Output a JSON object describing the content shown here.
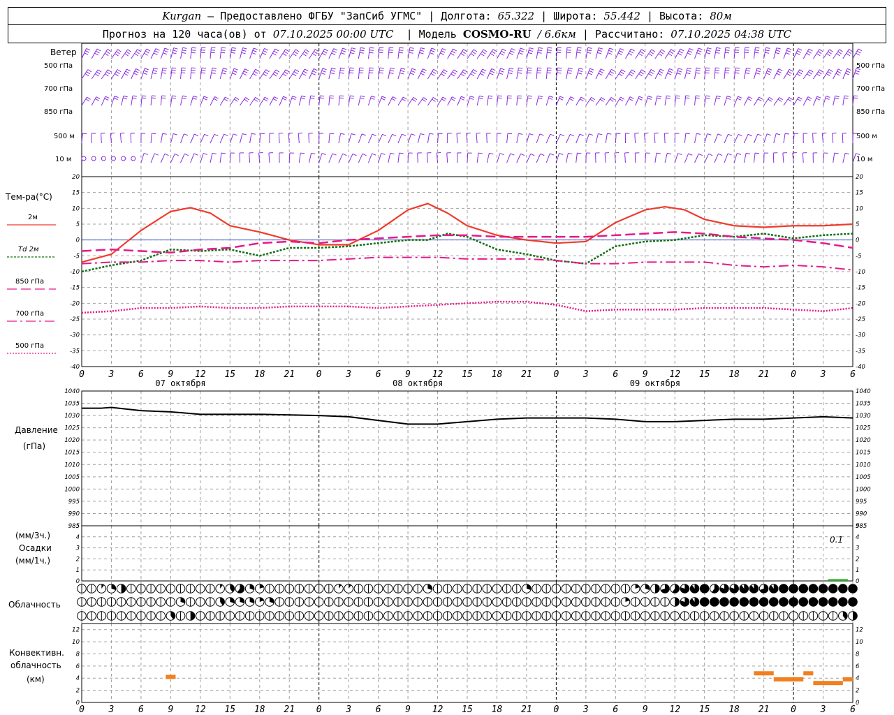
{
  "header": {
    "station": "Kurgan",
    "dash": "—",
    "provider": "Предоставлено ФГБУ \"ЗапСиб УГМС\"",
    "lon_label": "Долгота:",
    "lon": "65.322",
    "lat_label": "Широта:",
    "lat": "55.442",
    "alt_label": "Высота:",
    "alt": "80м",
    "forecast_label": "Прогноз на 120 часа(ов) от",
    "init_time": "07.10.2025 00:00 UTC",
    "model_label": "Модель",
    "model": "COSMO-RU",
    "resolution": "/ 6.6км",
    "calc_label": "Рассчитано:",
    "calc_time": "07.10.2025 04:38 UTC",
    "sep": "|"
  },
  "colors": {
    "wind": "#8a2be2",
    "t2m": "#ef3b2c",
    "td2m": "#107010",
    "t850": "#e6198a",
    "t700": "#e6198a",
    "t500": "#e6198a",
    "pressure": "#000000",
    "precip": "#20b020",
    "convective": "#f08020",
    "grid": "#a0a0a0"
  },
  "wind_panel": {
    "title": "Ветер",
    "levels": [
      "500 гПа",
      "700 гПа",
      "850 гПа",
      "500 м",
      "10 м"
    ]
  },
  "temp_panel": {
    "title": "Тем-ра(°С)",
    "legend": [
      {
        "label": "2м",
        "style": "solid"
      },
      {
        "label": "Td  2м",
        "style": "dotted"
      },
      {
        "label": "850 гПа",
        "style": "dashed"
      },
      {
        "label": "700 гПа",
        "style": "dashdot"
      },
      {
        "label": "500 гПа",
        "style": "fine-dotted"
      }
    ]
  },
  "pressure_panel": {
    "title": "Давление",
    "unit": "(гПа)"
  },
  "precip_panel": {
    "unit_top": "(мм/3ч.)",
    "title": "Осадки",
    "unit_bottom": "(мм/1ч.)",
    "max_label": "0.1"
  },
  "cloud_panel": {
    "title": "Облачность"
  },
  "conv_panel": {
    "title_1": "Конвективн.",
    "title_2": "облачность",
    "unit": "(км)"
  },
  "time_axis": {
    "tick_labels": [
      "0",
      "3",
      "6",
      "9",
      "12",
      "15",
      "18",
      "21",
      "0",
      "3",
      "6",
      "9",
      "12",
      "15",
      "18",
      "21",
      "0",
      "3",
      "6",
      "9",
      "12",
      "15",
      "18",
      "21",
      "0",
      "3",
      "6"
    ],
    "day_labels": [
      "07 октября",
      "08 октября",
      "09 октября"
    ]
  },
  "chart_data": [
    {
      "type": "line",
      "title": "Тем-ра(°С)",
      "x_unit": "hours since 07.10.2025 00:00 UTC",
      "ylim": [
        -40,
        20
      ],
      "yticks": [
        20,
        15,
        10,
        5,
        0,
        -5,
        -10,
        -15,
        -20,
        -25,
        -30,
        -35,
        -40
      ],
      "series": [
        {
          "name": "2м",
          "points": [
            [
              0,
              -7
            ],
            [
              3,
              -4.5
            ],
            [
              6,
              3
            ],
            [
              9,
              9
            ],
            [
              11,
              10.2
            ],
            [
              13,
              8.5
            ],
            [
              15,
              4.5
            ],
            [
              18,
              2.5
            ],
            [
              21,
              0
            ],
            [
              24,
              -1.5
            ],
            [
              27,
              -1.5
            ],
            [
              30,
              3
            ],
            [
              33,
              9.5
            ],
            [
              35,
              11.5
            ],
            [
              37,
              8.5
            ],
            [
              39,
              4.5
            ],
            [
              42,
              1.5
            ],
            [
              45,
              0
            ],
            [
              48,
              -1
            ],
            [
              51,
              -0.5
            ],
            [
              54,
              5.5
            ],
            [
              57,
              9.5
            ],
            [
              59,
              10.5
            ],
            [
              61,
              9.5
            ],
            [
              63,
              6.5
            ],
            [
              66,
              4.5
            ],
            [
              69,
              4
            ],
            [
              72,
              4.5
            ],
            [
              75,
              4.5
            ],
            [
              78,
              5
            ]
          ]
        },
        {
          "name": "Td  2м",
          "points": [
            [
              0,
              -10
            ],
            [
              3,
              -8
            ],
            [
              6,
              -6.5
            ],
            [
              9,
              -3
            ],
            [
              12,
              -3.5
            ],
            [
              15,
              -3
            ],
            [
              18,
              -5
            ],
            [
              21,
              -2.5
            ],
            [
              24,
              -2.5
            ],
            [
              27,
              -2
            ],
            [
              30,
              -1
            ],
            [
              33,
              0
            ],
            [
              35,
              0
            ],
            [
              37,
              2
            ],
            [
              39,
              1
            ],
            [
              42,
              -3
            ],
            [
              45,
              -4.5
            ],
            [
              48,
              -6.5
            ],
            [
              51,
              -7.5
            ],
            [
              54,
              -2
            ],
            [
              57,
              -0.5
            ],
            [
              60,
              0
            ],
            [
              63,
              1.5
            ],
            [
              66,
              1
            ],
            [
              69,
              2
            ],
            [
              72,
              0.5
            ],
            [
              75,
              1.5
            ],
            [
              78,
              2
            ]
          ]
        },
        {
          "name": "850 гПа",
          "points": [
            [
              0,
              -3.5
            ],
            [
              3,
              -3
            ],
            [
              6,
              -3.5
            ],
            [
              9,
              -4
            ],
            [
              12,
              -3
            ],
            [
              15,
              -2.5
            ],
            [
              18,
              -1
            ],
            [
              21,
              -0.5
            ],
            [
              24,
              -1
            ],
            [
              27,
              0
            ],
            [
              30,
              0.5
            ],
            [
              33,
              1
            ],
            [
              36,
              1.5
            ],
            [
              39,
              1.5
            ],
            [
              42,
              1
            ],
            [
              45,
              1
            ],
            [
              48,
              1
            ],
            [
              51,
              1
            ],
            [
              54,
              1.5
            ],
            [
              57,
              2
            ],
            [
              60,
              2.5
            ],
            [
              63,
              2
            ],
            [
              66,
              1
            ],
            [
              69,
              0.5
            ],
            [
              72,
              0
            ],
            [
              75,
              -1
            ],
            [
              78,
              -2.5
            ]
          ]
        },
        {
          "name": "700 гПа",
          "points": [
            [
              0,
              -7.5
            ],
            [
              3,
              -7
            ],
            [
              6,
              -7
            ],
            [
              9,
              -6.5
            ],
            [
              12,
              -6.5
            ],
            [
              15,
              -7
            ],
            [
              18,
              -6.5
            ],
            [
              21,
              -6.5
            ],
            [
              24,
              -6.5
            ],
            [
              27,
              -6
            ],
            [
              30,
              -5.5
            ],
            [
              33,
              -5.5
            ],
            [
              36,
              -5.5
            ],
            [
              39,
              -6
            ],
            [
              42,
              -6
            ],
            [
              45,
              -6
            ],
            [
              48,
              -6.5
            ],
            [
              51,
              -7.5
            ],
            [
              54,
              -7.5
            ],
            [
              57,
              -7
            ],
            [
              60,
              -7
            ],
            [
              63,
              -7
            ],
            [
              66,
              -8
            ],
            [
              69,
              -8.5
            ],
            [
              72,
              -8
            ],
            [
              75,
              -8.5
            ],
            [
              78,
              -9.5
            ]
          ]
        },
        {
          "name": "500 гПа",
          "points": [
            [
              0,
              -23
            ],
            [
              3,
              -22.5
            ],
            [
              6,
              -21.5
            ],
            [
              9,
              -21.5
            ],
            [
              12,
              -21
            ],
            [
              15,
              -21.5
            ],
            [
              18,
              -21.5
            ],
            [
              21,
              -21
            ],
            [
              24,
              -21
            ],
            [
              27,
              -21
            ],
            [
              30,
              -21.5
            ],
            [
              33,
              -21
            ],
            [
              36,
              -20.5
            ],
            [
              39,
              -20
            ],
            [
              42,
              -19.5
            ],
            [
              45,
              -19.5
            ],
            [
              48,
              -20.5
            ],
            [
              51,
              -22.5
            ],
            [
              54,
              -22
            ],
            [
              57,
              -22
            ],
            [
              60,
              -22
            ],
            [
              63,
              -21.5
            ],
            [
              66,
              -21.5
            ],
            [
              69,
              -21.5
            ],
            [
              72,
              -22
            ],
            [
              75,
              -22.5
            ],
            [
              78,
              -21.5
            ]
          ]
        }
      ]
    },
    {
      "type": "line",
      "title": "Давление",
      "x_unit": "hours since 07.10.2025 00:00 UTC",
      "ylim": [
        985,
        1040
      ],
      "yticks": [
        1040,
        1035,
        1030,
        1025,
        1020,
        1015,
        1010,
        1005,
        1000,
        995,
        990,
        985
      ],
      "series": [
        {
          "points": [
            [
              0,
              1033
            ],
            [
              2,
              1033
            ],
            [
              3,
              1033.3
            ],
            [
              6,
              1032
            ],
            [
              9,
              1031.5
            ],
            [
              12,
              1030.5
            ],
            [
              18,
              1030.5
            ],
            [
              24,
              1030
            ],
            [
              27,
              1029.5
            ],
            [
              30,
              1028
            ],
            [
              33,
              1026.5
            ],
            [
              36,
              1026.5
            ],
            [
              39,
              1027.5
            ],
            [
              42,
              1028.5
            ],
            [
              45,
              1029
            ],
            [
              48,
              1029
            ],
            [
              51,
              1029
            ],
            [
              54,
              1028.5
            ],
            [
              57,
              1027.5
            ],
            [
              60,
              1027.5
            ],
            [
              63,
              1028
            ],
            [
              66,
              1028.5
            ],
            [
              69,
              1028.5
            ],
            [
              72,
              1029
            ],
            [
              75,
              1029.5
            ],
            [
              78,
              1029
            ]
          ]
        }
      ]
    },
    {
      "type": "bar",
      "title": "Осадки",
      "x_unit": "hours since 07.10.2025 00:00 UTC",
      "ylim": [
        0,
        5
      ],
      "yticks": [
        5,
        4,
        3,
        2,
        1,
        0
      ],
      "values": [
        [
          76,
          0.1
        ],
        [
          77,
          0.1
        ]
      ]
    },
    {
      "type": "table",
      "title": "Облачность",
      "hours": [
        0,
        1,
        2,
        3,
        4,
        5,
        6,
        7,
        8,
        9,
        10,
        11,
        12,
        13,
        14,
        15,
        16,
        17,
        18,
        19,
        20,
        21,
        22,
        23,
        24,
        25,
        26,
        27,
        28,
        29,
        30,
        31,
        32,
        33,
        34,
        35,
        36,
        37,
        38,
        39,
        40,
        41,
        42,
        43,
        44,
        45,
        46,
        47,
        48,
        49,
        50,
        51,
        52,
        53,
        54,
        55,
        56,
        57,
        58,
        59,
        60,
        61,
        62,
        63,
        64,
        65,
        66,
        67,
        68,
        69,
        70,
        71,
        72,
        73,
        74,
        75,
        76,
        77,
        78
      ],
      "rows_fraction": [
        [
          0,
          0,
          0.1,
          0.3,
          0.5,
          0,
          0,
          0,
          0,
          0,
          0,
          0,
          0,
          0,
          0.1,
          0.4,
          0.6,
          0.3,
          0.2,
          0,
          0,
          0,
          0,
          0,
          0,
          0,
          0.1,
          0.1,
          0,
          0,
          0,
          0,
          0,
          0,
          0,
          0.3,
          0,
          0,
          0,
          0,
          0,
          0,
          0,
          0,
          0,
          0.3,
          0,
          0,
          0,
          0,
          0,
          0,
          0,
          0,
          0,
          0,
          0.2,
          0.3,
          0.5,
          0.7,
          0.6,
          0.8,
          0.9,
          1,
          0.6,
          0.8,
          0.8,
          0.9,
          0.9,
          0.7,
          0.9,
          1,
          1,
          1,
          1,
          1,
          1,
          1,
          1
        ],
        [
          0,
          0,
          0,
          0,
          0,
          0,
          0,
          0,
          0,
          0,
          0.3,
          0,
          0,
          0,
          0.4,
          0.3,
          0.3,
          0.3,
          0.2,
          0.3,
          0,
          0,
          0,
          0,
          0,
          0,
          0,
          0,
          0,
          0,
          0,
          0,
          0,
          0,
          0,
          0,
          0,
          0,
          0,
          0,
          0,
          0,
          0,
          0,
          0,
          0,
          0,
          0,
          0,
          0,
          0,
          0,
          0,
          0,
          0,
          0.2,
          0,
          0,
          0,
          0,
          0.5,
          0.8,
          0.9,
          1,
          1,
          1,
          1,
          1,
          1,
          1,
          1,
          1,
          1,
          1,
          1,
          1,
          1,
          1,
          1
        ],
        [
          0,
          0,
          0,
          0,
          0,
          0,
          0,
          0,
          0,
          0.4,
          0,
          0.5,
          0,
          0,
          0,
          0,
          0,
          0,
          0,
          0,
          0,
          0,
          0,
          0,
          0,
          0,
          0,
          0,
          0,
          0,
          0,
          0,
          0,
          0,
          0,
          0,
          0,
          0,
          0,
          0,
          0,
          0,
          0,
          0,
          0,
          0,
          0,
          0,
          0,
          0,
          0,
          0,
          0,
          0,
          0,
          0,
          0,
          0,
          0,
          0,
          0,
          0,
          0,
          0,
          0,
          0,
          0,
          0,
          0,
          0,
          0,
          0,
          0,
          0,
          0,
          0,
          0,
          0.4,
          0.5
        ]
      ]
    },
    {
      "type": "bar",
      "title": "Конвективн. облачность",
      "x_unit": "hours since 07.10.2025 00:00 UTC",
      "ylim": [
        0,
        13
      ],
      "yticks": [
        12,
        10,
        8,
        6,
        4,
        2,
        0
      ],
      "segments": [
        [
          8.5,
          9.5,
          4.2
        ],
        [
          68,
          70,
          4.8
        ],
        [
          70,
          72,
          3.8
        ],
        [
          72,
          73,
          3.8
        ],
        [
          73,
          74,
          4.8
        ],
        [
          74,
          75,
          3.2
        ],
        [
          75,
          77,
          3.2
        ],
        [
          77,
          78,
          3.8
        ]
      ]
    }
  ]
}
